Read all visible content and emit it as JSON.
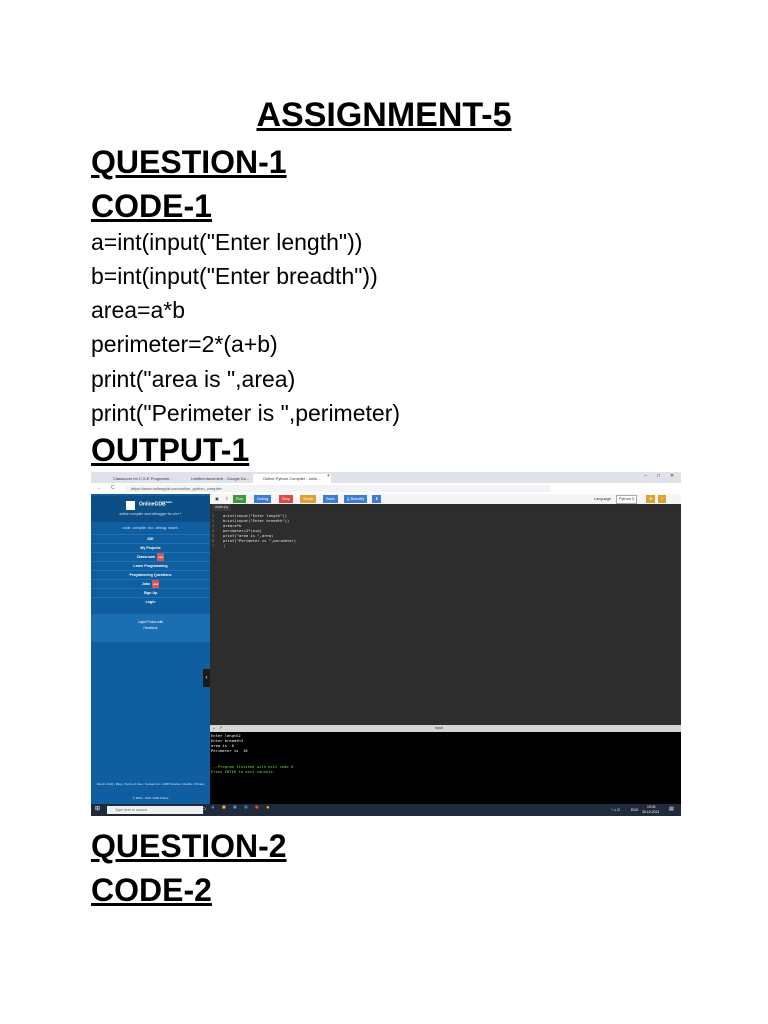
{
  "document": {
    "title": "ASSIGNMENT-5",
    "question1": "QUESTION-1",
    "code1_heading": "CODE-1",
    "code1_lines": [
      "a=int(input(\"Enter length\"))",
      "b=int(input(\"Enter breadth\"))",
      "area=a*b",
      "perimeter=2*(a+b)",
      "print(\"area is \",area)",
      "print(\"Perimeter is \",perimeter)"
    ],
    "output1_heading": "OUTPUT-1",
    "question2": "QUESTION-2",
    "code2_heading": "CODE-2"
  },
  "screenshot": {
    "tabs": [
      "Classroom for C.S.E Programm...",
      "Untitled document - Google Do...",
      "Online Python Compiler - onlin..."
    ],
    "new_tab": "+",
    "window_controls": [
      "–",
      "□",
      "✕"
    ],
    "url": "https://www.onlinegdb.com/online_python_compiler",
    "nav_icons": [
      "←",
      "C"
    ],
    "sidebar": {
      "brand": "OnlineGDB",
      "brand_sup": "beta",
      "tagline": "online compiler and debugger for c/c++",
      "slogan": "code. compile. run. debug. share.",
      "items": [
        "IDE",
        "My Projects",
        "Classroom",
        "Learn Programming",
        "Programming Questions",
        "Jobs",
        "Sign Up",
        "Login"
      ],
      "new_badge": "new",
      "login_with": "Login/ Follow with",
      "login_provider": "Facebook",
      "footer": "About • FAQ • Blog • Terms of Use • Contact Us • GDB Tutorial • Credits • Privacy",
      "copyright": "© 2016 - 2021 GDB Online"
    },
    "toolbar": {
      "buttons": [
        "Run",
        "Debug",
        "Stop",
        "Share",
        "Save",
        "{} Beautify",
        "⬇"
      ],
      "language_label": "Language",
      "language": "Python 3"
    },
    "file_tab": "main.py",
    "editor_lines": [
      "a=int(input(\"Enter length\"))",
      "b=int(input(\"Enter breadth\"))",
      "area=a*b",
      "perimeter=2*(a+b)",
      "print(\"area is \",area)",
      "print(\"Perimeter is \",perimeter)",
      ""
    ],
    "line_numbers": [
      "1",
      "2",
      "3",
      "4",
      "5",
      "6",
      "7"
    ],
    "io_label": "input",
    "console_lines": [
      "Enter length2",
      "Enter breadth3",
      "area is  6",
      "Perimeter is  10"
    ],
    "console_finished": "...Program finished with exit code 0",
    "console_prompt": "Press ENTER to exit console.",
    "taskbar": {
      "search": "Type here to search",
      "lang": "ENG",
      "time": "19:02",
      "date": "30-10-2021"
    },
    "colors": {
      "run": "#3c9a3c",
      "debug": "#3b7dd8",
      "stop": "#e04848",
      "share": "#e0a030",
      "save": "#3b7dd8",
      "beautify": "#3b7dd8",
      "download": "#3b7dd8",
      "sidebar": "#0f5fa0",
      "editor_bg": "#2d2d2d",
      "console_green": "#7cd53b"
    }
  }
}
